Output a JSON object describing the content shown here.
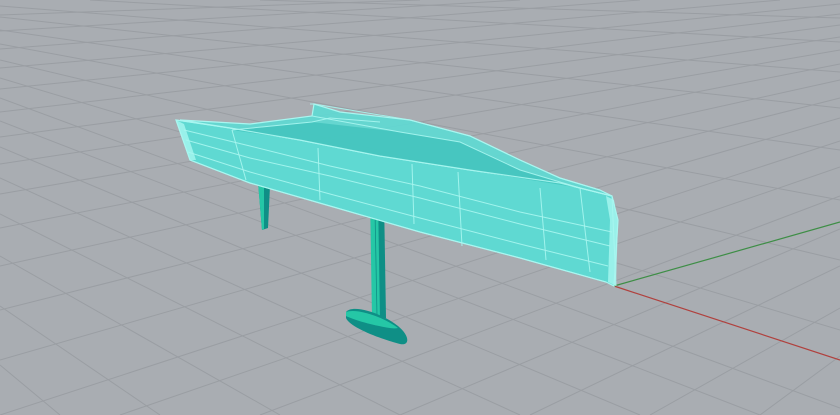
{
  "viewport": {
    "background_color": "#a9adb2",
    "grid_color": "#9a9ea3",
    "grid_major_color": "#8e9297",
    "x_axis_color": "#b0413e",
    "y_axis_color": "#3e8e46"
  },
  "model": {
    "display_mode": "shaded-wireframe",
    "surface_color": "#5fd9d2",
    "surface_dark_color": "#2fb9b3",
    "edge_color": "#a8f6f0",
    "appendage_color": "#25c7a6",
    "appendage_dark_color": "#0f8f86",
    "parts": [
      "hull",
      "deck",
      "rudder",
      "daggerboard",
      "foil"
    ]
  }
}
